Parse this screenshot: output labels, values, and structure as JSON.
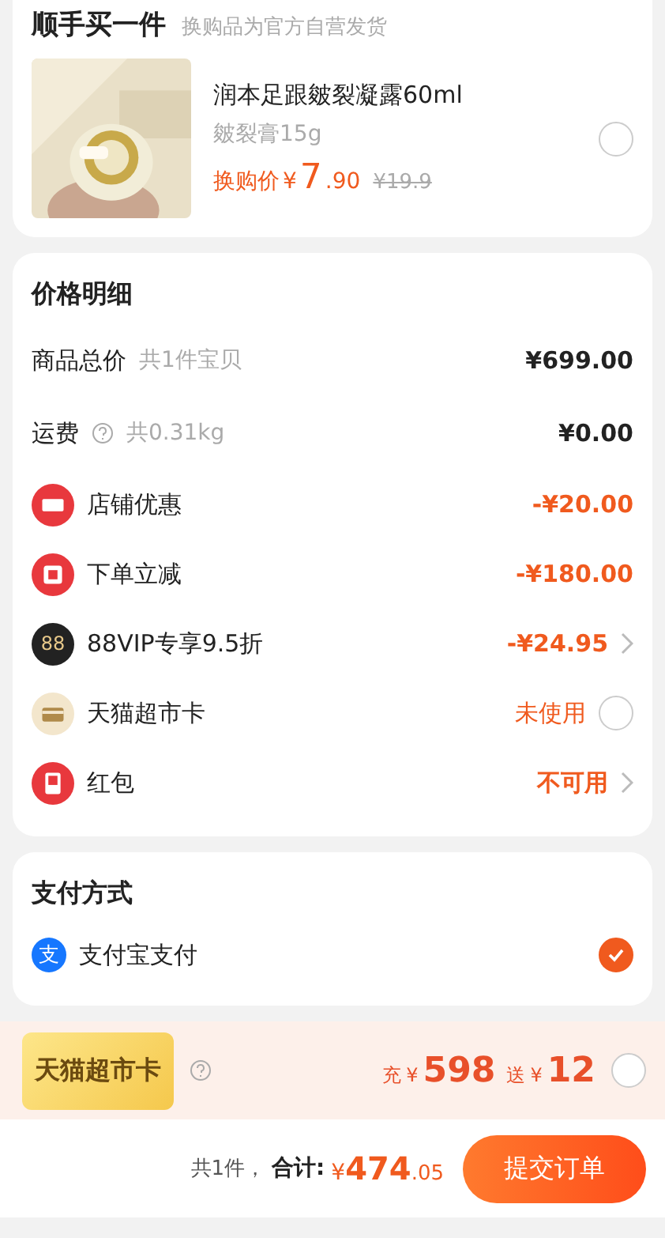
{
  "addon": {
    "title": "顺手买一件",
    "subtitle": "换购品为官方自营发货",
    "product": {
      "kind": "picture",
      "name": "润本足跟皴裂凝露60ml",
      "spec": "皴裂膏15g",
      "price_label": "换购价",
      "currency": "¥",
      "price_int": "7",
      "price_dec": ".90",
      "original_price": "¥19.9",
      "selected": false
    }
  },
  "price_detail": {
    "title": "价格明细",
    "rows": [
      {
        "kind": "total",
        "label": "商品总价",
        "note": "共1件宝贝",
        "value": "¥699.00"
      },
      {
        "kind": "total",
        "label": "运费",
        "help": true,
        "note": "共0.31kg",
        "value": "¥0.00"
      },
      {
        "kind": "discount",
        "label": "店铺优惠",
        "value": "-¥20.00"
      },
      {
        "kind": "discount",
        "label": "下单立减",
        "value": "-¥180.00"
      },
      {
        "kind": "discount",
        "icon_text": "88",
        "label": "88VIP专享9.5折",
        "value": "-¥24.95",
        "chevron": true
      },
      {
        "kind": "option",
        "label": "天猫超市卡",
        "value": "未使用",
        "checked": false
      },
      {
        "kind": "discount",
        "label": "红包",
        "value": "不可用",
        "chevron": true
      }
    ]
  },
  "payment": {
    "title": "支付方式",
    "methods": [
      {
        "icon_text": "支",
        "label": "支付宝支付",
        "selected": true
      }
    ]
  },
  "promo": {
    "badge": "天猫超市卡",
    "recharge_label": "充",
    "recharge_currency": "¥",
    "recharge_amount": "598",
    "bonus_label": "送",
    "bonus_currency": "¥",
    "bonus_amount": "12",
    "checked": false
  },
  "footer": {
    "count": "共1件，",
    "total_label": "合计:",
    "currency": "¥",
    "total_int": "474",
    "total_dec": ".05",
    "submit": "提交订单"
  }
}
